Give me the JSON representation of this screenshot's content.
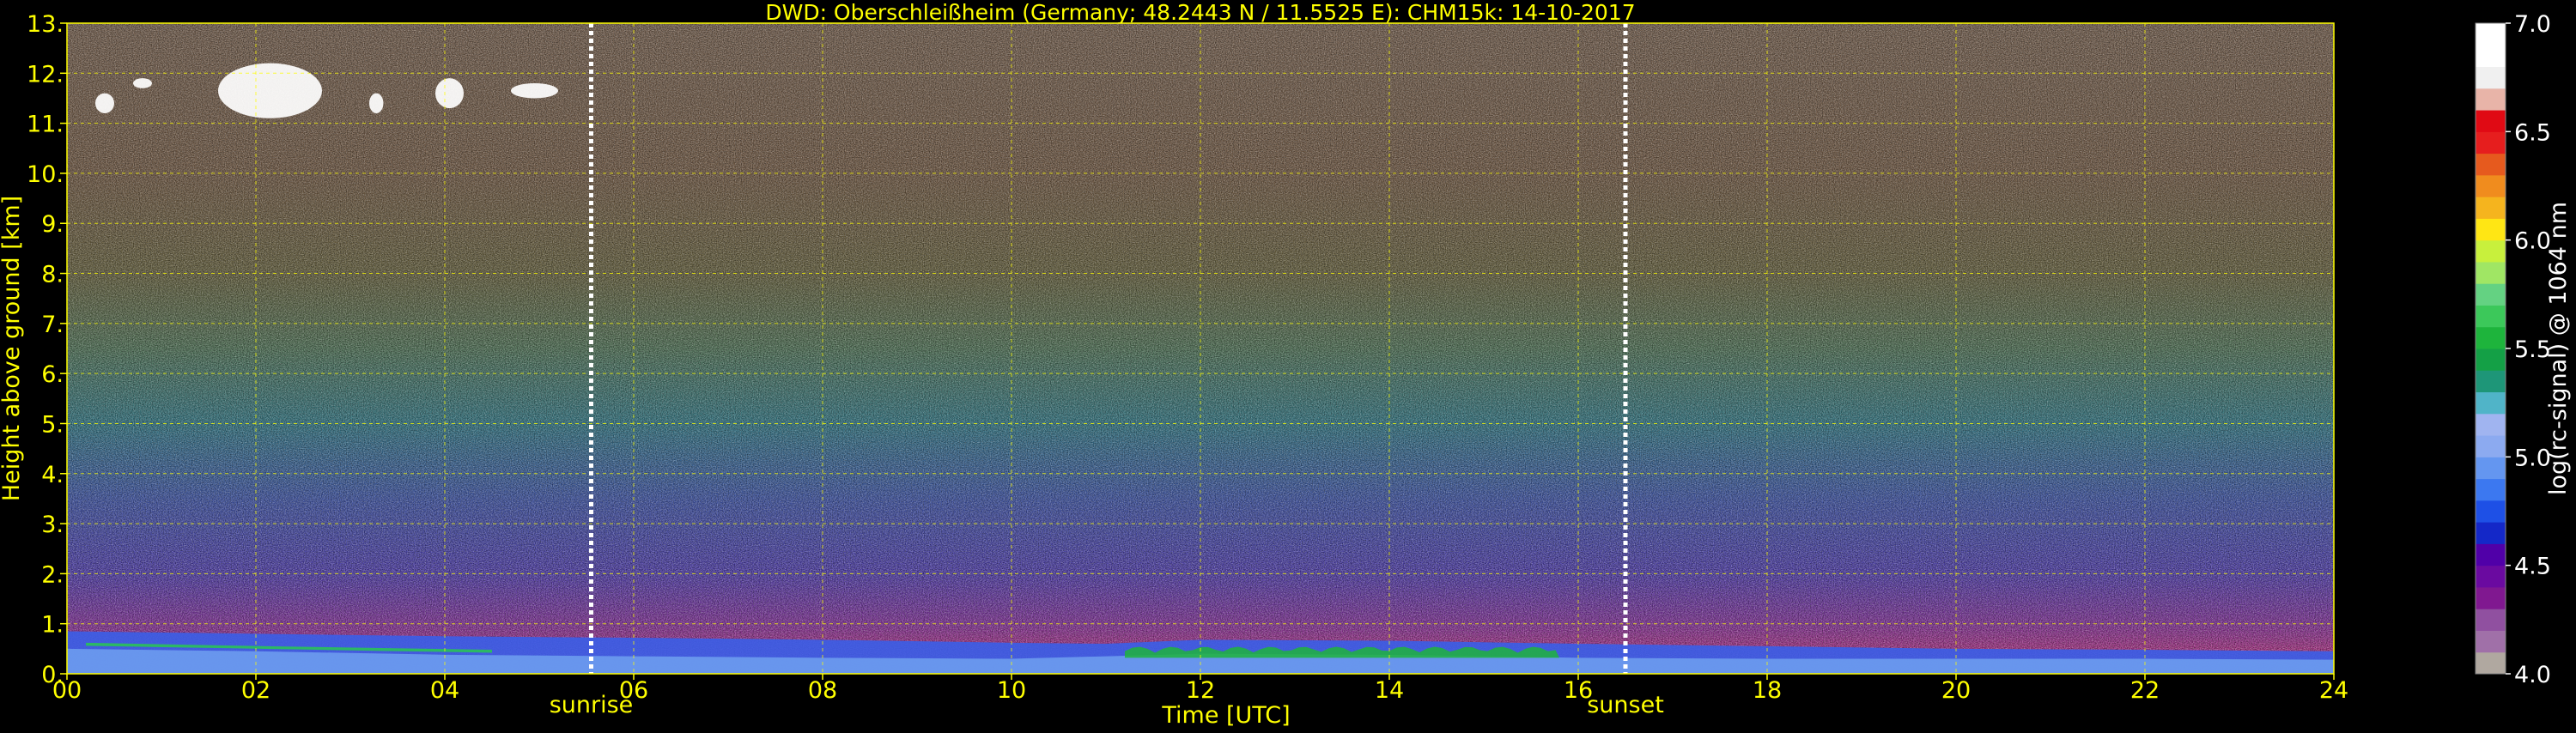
{
  "chart_data": {
    "type": "heatmap",
    "title": "DWD: Oberschleißheim (Germany; 48.2443 N / 11.5525 E):    CHM15k: 14-10-2017",
    "xlabel": "Time [UTC]",
    "ylabel": "Height above ground [km]",
    "xlim": [
      0,
      24
    ],
    "ylim": [
      0,
      13
    ],
    "x_ticks": [
      0,
      2,
      4,
      6,
      8,
      10,
      12,
      14,
      16,
      18,
      20,
      22,
      24
    ],
    "x_tick_labels": [
      "00",
      "02",
      "04",
      "06",
      "08",
      "10",
      "12",
      "14",
      "16",
      "18",
      "20",
      "22",
      "24"
    ],
    "y_ticks": [
      0,
      1,
      2,
      3,
      4,
      5,
      6,
      7,
      8,
      9,
      10,
      11,
      12,
      13
    ],
    "y_tick_labels": [
      "0.",
      "1.",
      "2.",
      "3.",
      "4.",
      "5.",
      "6.",
      "7.",
      "8.",
      "9.",
      "10.",
      "11.",
      "12.",
      "13."
    ],
    "grid": true,
    "markers": [
      {
        "label": "sunrise",
        "x": 5.55
      },
      {
        "label": "sunset",
        "x": 16.5
      }
    ],
    "colorbar": {
      "label": "log(rc-signal) @ 1064 nm",
      "range": [
        4.0,
        7.0
      ],
      "tick_values": [
        4.0,
        4.5,
        5.0,
        5.5,
        6.0,
        6.5,
        7.0
      ],
      "tick_labels": [
        "4.0",
        "4.5",
        "5.0",
        "5.5",
        "6.0",
        "6.5",
        "7.0"
      ],
      "colors": [
        "#b0a8a0",
        "#a070a8",
        "#9050a0",
        "#801890",
        "#6a0aa0",
        "#5000a8",
        "#1428c8",
        "#1e50e6",
        "#3c78f0",
        "#6496f0",
        "#8caaf0",
        "#a0b4f0",
        "#50b4c8",
        "#1e9678",
        "#14a046",
        "#1eb43c",
        "#3cc85a",
        "#64d282",
        "#a0e664",
        "#c8f03c",
        "#ffe614",
        "#f5b41e",
        "#f08c1e",
        "#e65a1e",
        "#e61e1e",
        "#e00a14",
        "#e8b4a8",
        "#f0f0f0",
        "#ffffff",
        "#ffffff"
      ]
    },
    "layers": [
      {
        "name": "boundary-layer",
        "x": [
          0,
          2,
          4,
          6,
          8,
          10,
          11,
          12,
          14,
          16,
          18,
          20,
          22,
          24
        ],
        "top_km": [
          0.85,
          0.8,
          0.75,
          0.72,
          0.68,
          0.62,
          0.6,
          0.68,
          0.66,
          0.6,
          0.55,
          0.5,
          0.48,
          0.45
        ]
      },
      {
        "name": "surface-layer",
        "x": [
          0,
          2,
          4,
          6,
          8,
          10,
          12,
          14,
          16,
          18,
          20,
          22,
          24
        ],
        "top_km": [
          0.5,
          0.45,
          0.38,
          0.35,
          0.32,
          0.3,
          0.4,
          0.38,
          0.32,
          0.3,
          0.3,
          0.3,
          0.28
        ]
      }
    ],
    "clouds": [
      {
        "x": [
          0.3,
          0.5
        ],
        "y": [
          11.2,
          11.6
        ]
      },
      {
        "x": [
          0.7,
          0.9
        ],
        "y": [
          11.7,
          11.9
        ]
      },
      {
        "x": [
          1.6,
          2.7
        ],
        "y": [
          11.1,
          12.2
        ]
      },
      {
        "x": [
          3.2,
          3.35
        ],
        "y": [
          11.2,
          11.6
        ]
      },
      {
        "x": [
          3.9,
          4.2
        ],
        "y": [
          11.3,
          11.9
        ]
      },
      {
        "x": [
          4.7,
          5.2
        ],
        "y": [
          11.5,
          11.8
        ]
      }
    ],
    "background_gradient": [
      {
        "height_km": 0,
        "color": "#c0306e"
      },
      {
        "height_km": 1.0,
        "color": "#7a2f8f"
      },
      {
        "height_km": 2.0,
        "color": "#4b3aa0"
      },
      {
        "height_km": 3.5,
        "color": "#3b4f9a"
      },
      {
        "height_km": 5.0,
        "color": "#2f6e7a"
      },
      {
        "height_km": 6.5,
        "color": "#4a6a50"
      },
      {
        "height_km": 8.0,
        "color": "#5f5a3a"
      },
      {
        "height_km": 10.0,
        "color": "#6a5440"
      },
      {
        "height_km": 13.0,
        "color": "#6e5a4a"
      }
    ]
  }
}
